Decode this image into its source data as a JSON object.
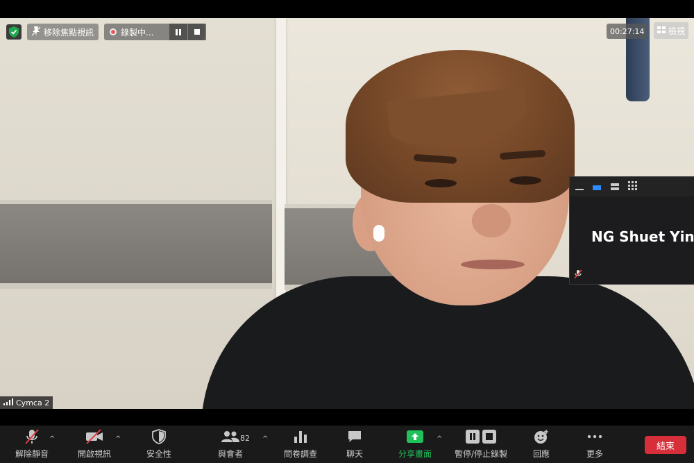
{
  "top_left": {
    "unpin_label": "移除焦點視訊",
    "recording_label": "錄製中..."
  },
  "top_right": {
    "timer": "00:27:14",
    "view_label": "檢視"
  },
  "thumbnail": {
    "participant_name": "NG Shuet Ying"
  },
  "video_label": {
    "name": "Cymca 2"
  },
  "toolbar": {
    "unmute_label": "解除靜音",
    "start_video_label": "開啟視訊",
    "security_label": "安全性",
    "participants_label": "與會者",
    "participants_count": "82",
    "polls_label": "問卷調查",
    "chat_label": "聊天",
    "share_label": "分享畫面",
    "record_label": "暫停/停止錄製",
    "reactions_label": "回應",
    "more_label": "更多",
    "end_label": "結束"
  },
  "colors": {
    "end_button": "#d62f3a",
    "share_green": "#20c15a",
    "toolbar_bg": "#1a1a1a",
    "security_green": "#1fa84f"
  }
}
